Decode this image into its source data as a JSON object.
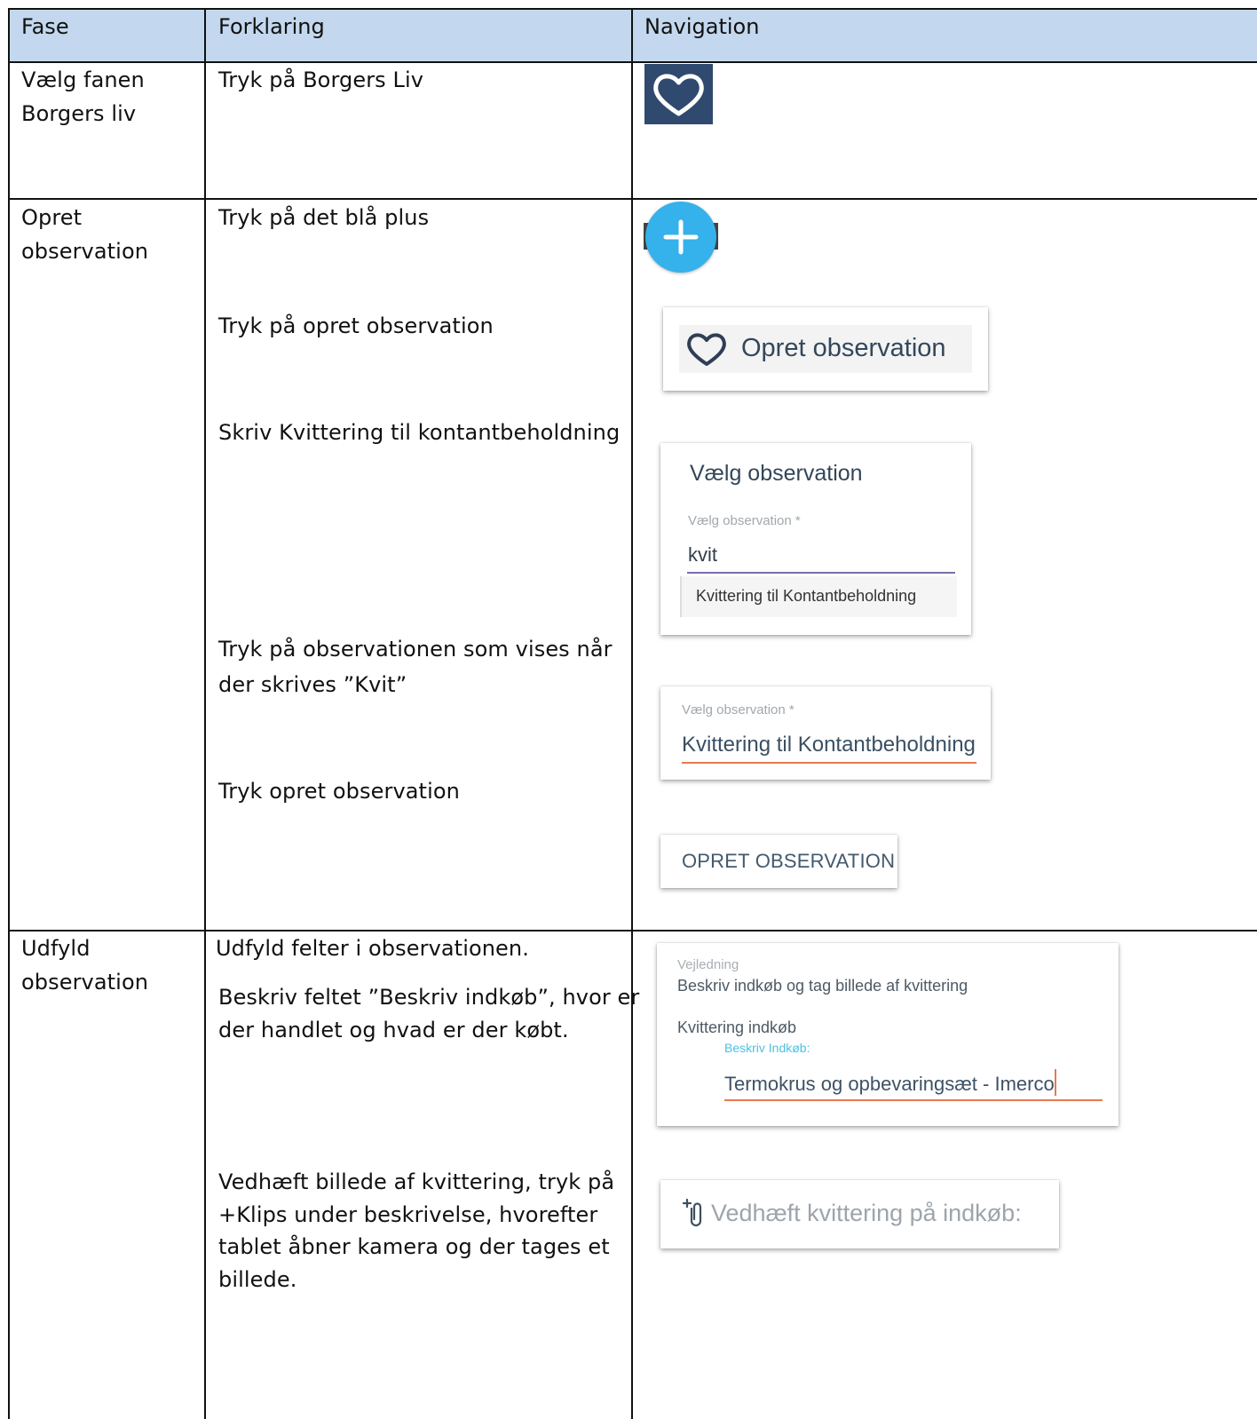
{
  "header": {
    "col1": "Fase",
    "col2": "Forklaring",
    "col3": "Navigation"
  },
  "rows": [
    {
      "fase": [
        "Vælg fanen",
        "Borgers liv"
      ],
      "steps": [
        "Tryk på Borgers Liv"
      ]
    },
    {
      "fase": [
        "Opret",
        "observation"
      ],
      "steps": [
        "Tryk på det blå plus",
        "Tryk på opret observation",
        "Skriv Kvittering til kontantbeholdning",
        [
          "Tryk på observationen som vises når",
          "der skrives ”Kvit”"
        ],
        "Tryk opret observation"
      ]
    },
    {
      "fase": [
        "Udfyld",
        "observation"
      ],
      "steps": [
        "Udfyld felter i observationen.",
        [
          "Beskriv feltet ”Beskriv indkøb”, hvor er",
          "der handlet og hvad er der købt."
        ],
        [
          "Vedhæft billede af kvittering, tryk på",
          "+Klips under beskrivelse, hvorefter",
          "tablet åbner kamera og der tages et",
          "billede."
        ]
      ]
    }
  ],
  "nav": {
    "heart_tab_icon": "heart-icon",
    "plus_fab_icon": "plus-icon",
    "opret_menu_label": "Opret observation",
    "dialog_title": "Vælg observation",
    "select_label": "Vælg observation *",
    "search_value": "kvit",
    "suggestion": "Kvittering til Kontantbeholdning",
    "select_label_2": "Vælg observation *",
    "selected_value": "Kvittering til Kontantbeholdning",
    "opret_button": "OPRET OBSERVATION",
    "vejledning_label": "Vejledning",
    "vejledning_text": "Beskriv indkøb og tag billede af kvittering",
    "kvittering_label": "Kvittering indkøb",
    "beskriv_label": "Beskriv Indkøb:",
    "beskriv_value": "Termokrus og opbevaringsæt - Imerco",
    "attach_label": "Vedhæft kvittering på indkøb:",
    "attach_icon": "paperclip-plus-icon"
  },
  "colors": {
    "header_bg": "#c3d8ee",
    "heart_tile": "#2f4a6e",
    "fab_blue": "#35b1ec",
    "underline_purple": "#7b6ea8",
    "underline_orange": "#e8794d",
    "beskriv_label_blue": "#4fc0e0"
  }
}
